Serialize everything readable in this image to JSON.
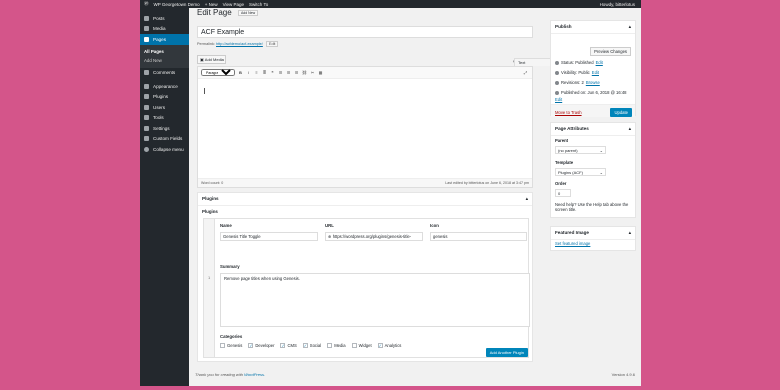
{
  "adminbar": {
    "site": "WP Georgetown Demo",
    "new": "+ New",
    "view": "View Page",
    "switch": "Switch To",
    "howdy": "Howdy, bitterlotus"
  },
  "sidebar": {
    "items": [
      {
        "label": "Posts",
        "icon": "pin-icon"
      },
      {
        "label": "Media",
        "icon": "media-icon"
      },
      {
        "label": "Pages",
        "icon": "pages-icon"
      },
      {
        "label": "Comments",
        "icon": "comments-icon"
      },
      {
        "label": "Appearance",
        "icon": "appearance-icon"
      },
      {
        "label": "Plugins",
        "icon": "plugins-icon"
      },
      {
        "label": "Users",
        "icon": "users-icon"
      },
      {
        "label": "Tools",
        "icon": "tools-icon"
      },
      {
        "label": "Settings",
        "icon": "settings-icon"
      },
      {
        "label": "Custom Fields",
        "icon": "custom-fields-icon"
      },
      {
        "label": "Collapse menu",
        "icon": "collapse-icon"
      }
    ],
    "submenu": [
      "All Pages",
      "Add New"
    ]
  },
  "page": {
    "heading": "Edit Page",
    "add_new": "Add New",
    "title": "ACF Example",
    "permalink_label": "Permalink:",
    "permalink_url": "http://acfdemo/acf-example/",
    "edit_btn": "Edit"
  },
  "editor": {
    "add_media": "Add Media",
    "tab_visual": "Visual",
    "tab_text": "Text",
    "format": "Paragraph",
    "word_count": "Word count: 0",
    "last_edited": "Last edited by bitterlotus on June 6, 2018 at 3:47 pm"
  },
  "plugins_box": {
    "title": "Plugins",
    "subtitle": "Plugins",
    "name_label": "Name",
    "url_label": "URL",
    "icon_label": "Icon",
    "name_value": "Genesis Title Toggle",
    "url_value": "https://wordpress.org/plugins/genesis-title-",
    "icon_value": "genesis",
    "summary_label": "Summary",
    "summary_value": "Remove page titles when using Genesis.",
    "categories_label": "Categories",
    "categories": [
      {
        "label": "Genesis",
        "checked": false
      },
      {
        "label": "Developer",
        "checked": true
      },
      {
        "label": "CMS",
        "checked": true
      },
      {
        "label": "Social",
        "checked": true
      },
      {
        "label": "Media",
        "checked": false
      },
      {
        "label": "Widget",
        "checked": false
      },
      {
        "label": "Analytics",
        "checked": true
      }
    ],
    "add_row": "Add Another Plugin",
    "row_number": "1"
  },
  "publish": {
    "title": "Publish",
    "preview": "Preview Changes",
    "status": "Status: Published",
    "visibility": "Visibility: Public",
    "revisions": "Revisions: 2",
    "browse": "Browse",
    "published_on": "Published on: Jun 6, 2018 @ 16:48",
    "edit": "Edit",
    "trash": "Move to Trash",
    "update": "Update"
  },
  "attributes": {
    "title": "Page Attributes",
    "parent_label": "Parent",
    "parent_value": "(no parent)",
    "template_label": "Template",
    "template_value": "Plugins (ACF)",
    "order_label": "Order",
    "order_value": "0",
    "help": "Need help? Use the Help tab above the screen title."
  },
  "featured": {
    "title": "Featured Image",
    "link": "Set featured image"
  },
  "footer": {
    "thanks": "Thank you for creating with",
    "wp": "WordPress.",
    "version": "Version 4.9.6"
  }
}
